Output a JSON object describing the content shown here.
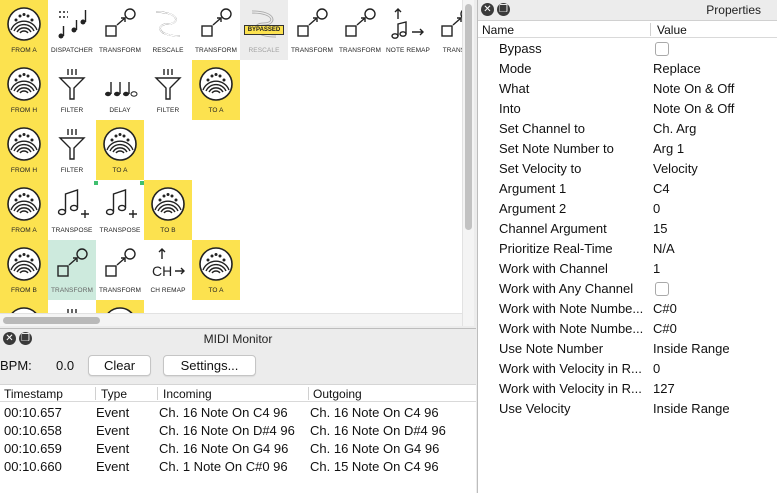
{
  "patch": {
    "nodes": [
      {
        "label": "FROM A",
        "icon": "midi-port-icon",
        "style": "yellow",
        "col": 0,
        "row": 0
      },
      {
        "label": "DISPATCHER",
        "icon": "dispatcher-icon",
        "style": "white",
        "col": 1,
        "row": 0
      },
      {
        "label": "TRANSFORM",
        "icon": "transform-icon",
        "style": "white",
        "col": 2,
        "row": 0
      },
      {
        "label": "RESCALE",
        "icon": "rescale-icon",
        "style": "white",
        "col": 3,
        "row": 0
      },
      {
        "label": "TRANSFORM",
        "icon": "transform-icon",
        "style": "white",
        "col": 4,
        "row": 0
      },
      {
        "label": "RESCALE",
        "icon": "rescale-icon",
        "style": "gray",
        "col": 5,
        "row": 0,
        "badge": "BYPASSED"
      },
      {
        "label": "TRANSFORM",
        "icon": "transform-icon",
        "style": "white",
        "col": 6,
        "row": 0
      },
      {
        "label": "TRANSFORM",
        "icon": "transform-icon",
        "style": "white",
        "col": 7,
        "row": 0
      },
      {
        "label": "NOTE REMAP",
        "icon": "note-remap-icon",
        "style": "white",
        "col": 8,
        "row": 0
      },
      {
        "label": "TRANSF",
        "icon": "transform-icon",
        "style": "white",
        "col": 9,
        "row": 0
      },
      {
        "label": "FROM H",
        "icon": "midi-port-icon",
        "style": "yellow",
        "col": 0,
        "row": 1
      },
      {
        "label": "FILTER",
        "icon": "filter-icon",
        "style": "white",
        "col": 1,
        "row": 1
      },
      {
        "label": "DELAY",
        "icon": "delay-icon",
        "style": "white",
        "col": 2,
        "row": 1
      },
      {
        "label": "FILTER",
        "icon": "filter-icon",
        "style": "white",
        "col": 3,
        "row": 1
      },
      {
        "label": "TO A",
        "icon": "midi-port-icon",
        "style": "yellow",
        "col": 4,
        "row": 1
      },
      {
        "label": "FROM H",
        "icon": "midi-port-icon",
        "style": "yellow",
        "col": 0,
        "row": 2
      },
      {
        "label": "FILTER",
        "icon": "filter-icon",
        "style": "white",
        "col": 1,
        "row": 2
      },
      {
        "label": "TO A",
        "icon": "midi-port-icon",
        "style": "yellow",
        "col": 2,
        "row": 2
      },
      {
        "label": "FROM A",
        "icon": "midi-port-icon",
        "style": "yellow",
        "col": 0,
        "row": 3
      },
      {
        "label": "TRANSPOSE",
        "icon": "transpose-icon",
        "style": "white",
        "col": 1,
        "row": 3
      },
      {
        "label": "TRANSPOSE",
        "icon": "transpose-icon",
        "style": "white",
        "col": 2,
        "row": 3
      },
      {
        "label": "TO B",
        "icon": "midi-port-icon",
        "style": "yellow",
        "col": 3,
        "row": 3
      },
      {
        "label": "FROM B",
        "icon": "midi-port-icon",
        "style": "yellow",
        "col": 0,
        "row": 4
      },
      {
        "label": "TRANSFORM",
        "icon": "transform-icon",
        "style": "teal",
        "col": 1,
        "row": 4
      },
      {
        "label": "TRANSFORM",
        "icon": "transform-icon",
        "style": "white",
        "col": 2,
        "row": 4
      },
      {
        "label": "CH REMAP",
        "icon": "channel-remap-icon",
        "style": "white",
        "col": 3,
        "row": 4
      },
      {
        "label": "TO A",
        "icon": "midi-port-icon",
        "style": "yellow",
        "col": 4,
        "row": 4
      }
    ],
    "partial_row": [
      {
        "icon": "midi-port-icon",
        "style": "yellow",
        "col": 0
      },
      {
        "icon": "filter-icon",
        "style": "white",
        "col": 1
      },
      {
        "icon": "midi-port-icon",
        "style": "yellow",
        "col": 2
      }
    ]
  },
  "monitor": {
    "title": "MIDI Monitor",
    "bpm_label": "BPM:",
    "bpm_value": "0.0",
    "clear_label": "Clear",
    "settings_label": "Settings...",
    "columns": [
      "Timestamp",
      "Type",
      "Incoming",
      "Outgoing"
    ],
    "rows": [
      {
        "timestamp": "00:10.657",
        "type": "Event",
        "incoming": "Ch. 16 Note On C4 96",
        "outgoing": "Ch. 16 Note On C4 96"
      },
      {
        "timestamp": "00:10.658",
        "type": "Event",
        "incoming": "Ch. 16 Note On D#4 96",
        "outgoing": "Ch. 16 Note On D#4 96"
      },
      {
        "timestamp": "00:10.659",
        "type": "Event",
        "incoming": "Ch. 16 Note On G4 96",
        "outgoing": "Ch. 16 Note On G4 96"
      },
      {
        "timestamp": "00:10.660",
        "type": "Event",
        "incoming": "Ch. 1 Note On C#0 96",
        "outgoing": "Ch. 15 Note On C4 96"
      }
    ]
  },
  "properties": {
    "title": "Properties",
    "columns": [
      "Name",
      "Value"
    ],
    "rows": [
      {
        "name": "Bypass",
        "kind": "checkbox",
        "checked": false
      },
      {
        "name": "Mode",
        "value": "Replace"
      },
      {
        "name": "What",
        "value": "Note On & Off"
      },
      {
        "name": "Into",
        "value": "Note On & Off"
      },
      {
        "name": "Set Channel to",
        "value": "Ch. Arg"
      },
      {
        "name": "Set Note Number to",
        "value": "Arg 1"
      },
      {
        "name": "Set Velocity to",
        "value": "Velocity"
      },
      {
        "name": "Argument 1",
        "value": "C4"
      },
      {
        "name": "Argument 2",
        "value": "0"
      },
      {
        "name": "Channel Argument",
        "value": "15"
      },
      {
        "name": "Prioritize Real-Time",
        "value": "N/A"
      },
      {
        "name": "Work with Channel",
        "value": "1"
      },
      {
        "name": "Work with Any Channel",
        "kind": "checkbox",
        "checked": false
      },
      {
        "name": "Work with Note Numbe...",
        "value": "C#0"
      },
      {
        "name": "Work with Note Numbe...",
        "value": "C#0"
      },
      {
        "name": "Use Note Number",
        "value": "Inside Range"
      },
      {
        "name": "Work with Velocity in R...",
        "value": "0"
      },
      {
        "name": "Work with Velocity in R...",
        "value": "127"
      },
      {
        "name": "Use Velocity",
        "value": "Inside Range"
      }
    ]
  }
}
